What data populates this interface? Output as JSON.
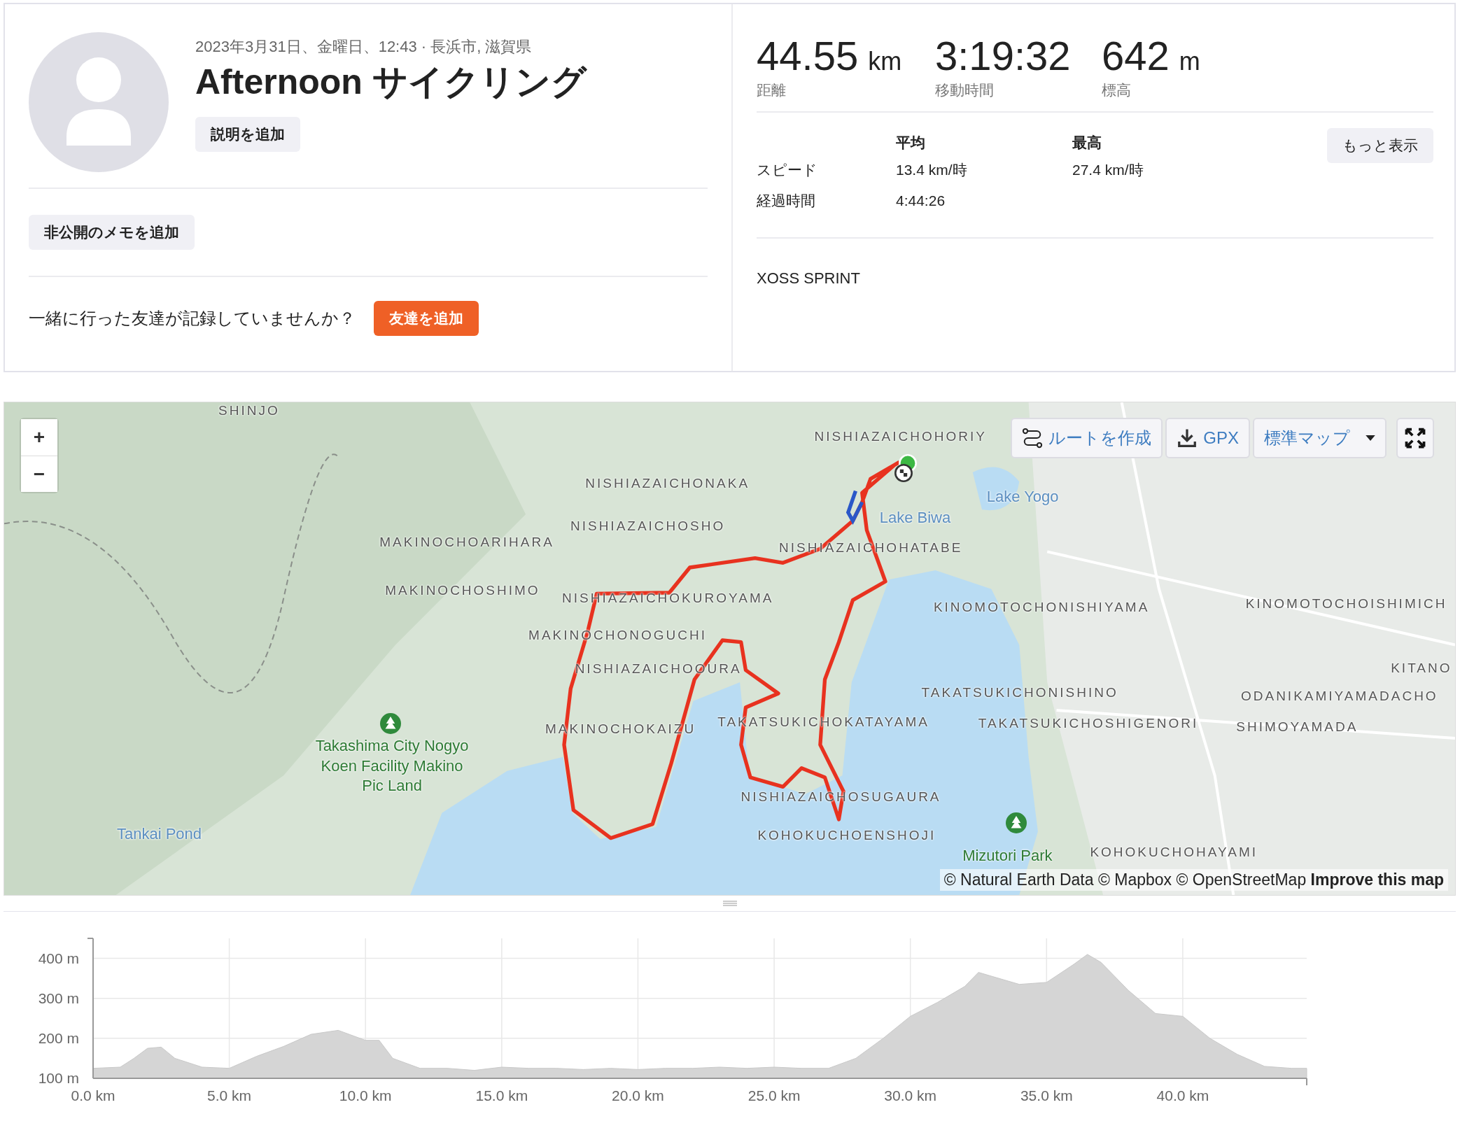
{
  "activity": {
    "date_location": "2023年3月31日、金曜日、12:43 · 長浜市, 滋賀県",
    "title": "Afternoon サイクリング",
    "add_description_button": "説明を追加",
    "private_note_button": "非公開のメモを追加",
    "friends_prompt": "一緒に行った友達が記録していませんか？",
    "add_friends_button": "友達を追加"
  },
  "stats": [
    {
      "value": "44.55",
      "unit": "km",
      "label": "距離"
    },
    {
      "value": "3:19:32",
      "label": "移動時間"
    },
    {
      "value": "642",
      "unit": "m",
      "label": "標高"
    }
  ],
  "stats_table": {
    "headers": [
      "平均",
      "最高"
    ],
    "rows": [
      {
        "label": "スピード",
        "cells": [
          "13.4 km/時",
          "27.4 km/時"
        ]
      },
      {
        "label": "経過時間",
        "cells": [
          "4:44:26"
        ]
      }
    ],
    "more_button": "もっと表示"
  },
  "device": "XOSS SPRINT",
  "map": {
    "zoom_in": "+",
    "zoom_out": "−",
    "toolbar": [
      {
        "kind": "route",
        "label": "ルートを作成"
      },
      {
        "kind": "download",
        "label": "GPX"
      },
      {
        "kind": "dropdown",
        "label": "標準マップ"
      },
      {
        "kind": "fullscreen"
      }
    ],
    "labels": [
      {
        "text": "SHINJO",
        "kind": "place"
      },
      {
        "text": "NISHIAZAICHOHORIY",
        "kind": "place"
      },
      {
        "text": "NISHIAZAICHONAKA",
        "kind": "place"
      },
      {
        "text": "NISHIAZAICHOSHO",
        "kind": "place"
      },
      {
        "text": "MAKINOCHOARIHARA",
        "kind": "place"
      },
      {
        "text": "NISHIAZAICHOHATABE",
        "kind": "place"
      },
      {
        "text": "MAKINOCHOSHIMO",
        "kind": "place"
      },
      {
        "text": "NISHIAZAICHOKUROYAMA",
        "kind": "place"
      },
      {
        "text": "MAKINOCHONOGUCHI",
        "kind": "place"
      },
      {
        "text": "NISHIAZAICHOOURA",
        "kind": "place"
      },
      {
        "text": "MAKINOCHOKAIZU",
        "kind": "place"
      },
      {
        "text": "TAKATSUKICHOKATAYAMA",
        "kind": "place"
      },
      {
        "text": "TAKATSUKICHONISHINO",
        "kind": "place"
      },
      {
        "text": "TAKATSUKICHOSHIGENORI",
        "kind": "place"
      },
      {
        "text": "KINOMOTOCHONISHIYAMA",
        "kind": "place"
      },
      {
        "text": "KINOMOTOCHOISHIMICH",
        "kind": "place"
      },
      {
        "text": "KITANO",
        "kind": "place"
      },
      {
        "text": "ODANIKAMIYAMADACHO",
        "kind": "place"
      },
      {
        "text": "SHIMOYAMADA",
        "kind": "place"
      },
      {
        "text": "NISHIAZAICHOSUGAURA",
        "kind": "place"
      },
      {
        "text": "KOHOKUCHOENSHOJI",
        "kind": "place"
      },
      {
        "text": "KOHOKUCHOHAYAMI",
        "kind": "place"
      },
      {
        "text": "Lake Yogo",
        "kind": "water"
      },
      {
        "text": "Lake Biwa",
        "kind": "water"
      },
      {
        "text": "Tankai Pond",
        "kind": "water"
      },
      {
        "text": "Takashima City Nogyo Koen Facility Makino Pic Land",
        "kind": "park"
      },
      {
        "text": "Mizutori Park",
        "kind": "park"
      }
    ],
    "attribution": "© Natural Earth Data © Mapbox © OpenStreetMap **Improve this map**"
  },
  "elevation": {
    "chart_data": {
      "type": "area",
      "x": [
        0,
        1,
        1.5,
        2,
        2.5,
        3,
        4,
        5,
        6,
        7,
        8,
        9,
        10,
        10.5,
        11,
        12,
        13,
        14,
        15,
        16,
        17,
        18,
        19,
        20,
        21,
        22,
        23,
        24,
        25,
        26,
        27,
        28,
        29,
        30,
        31,
        32,
        32.5,
        33,
        34,
        35,
        36,
        36.5,
        37,
        38,
        39,
        40,
        41,
        42,
        43,
        44,
        44.55
      ],
      "values": [
        125,
        128,
        150,
        175,
        178,
        150,
        128,
        125,
        155,
        180,
        210,
        220,
        195,
        195,
        150,
        125,
        125,
        120,
        128,
        125,
        125,
        122,
        125,
        122,
        125,
        125,
        128,
        125,
        128,
        125,
        125,
        150,
        200,
        255,
        290,
        330,
        365,
        355,
        335,
        340,
        385,
        410,
        390,
        320,
        262,
        255,
        200,
        160,
        130,
        125,
        125
      ],
      "xlim": [
        0,
        44.55
      ],
      "ylim": [
        100,
        450
      ],
      "grid": true,
      "xticks": [
        {
          "value": 0,
          "label": "0.0 km"
        },
        {
          "value": 5,
          "label": "5.0 km"
        },
        {
          "value": 10,
          "label": "10.0 km"
        },
        {
          "value": 15,
          "label": "15.0 km"
        },
        {
          "value": 20,
          "label": "20.0 km"
        },
        {
          "value": 25,
          "label": "25.0 km"
        },
        {
          "value": 30,
          "label": "30.0 km"
        },
        {
          "value": 35,
          "label": "35.0 km"
        },
        {
          "value": 40,
          "label": "40.0 km"
        }
      ],
      "yticks": [
        {
          "value": 100,
          "label": "100 m"
        },
        {
          "value": 200,
          "label": "200 m"
        },
        {
          "value": 300,
          "label": "300 m"
        },
        {
          "value": 400,
          "label": "400 m"
        }
      ]
    }
  }
}
